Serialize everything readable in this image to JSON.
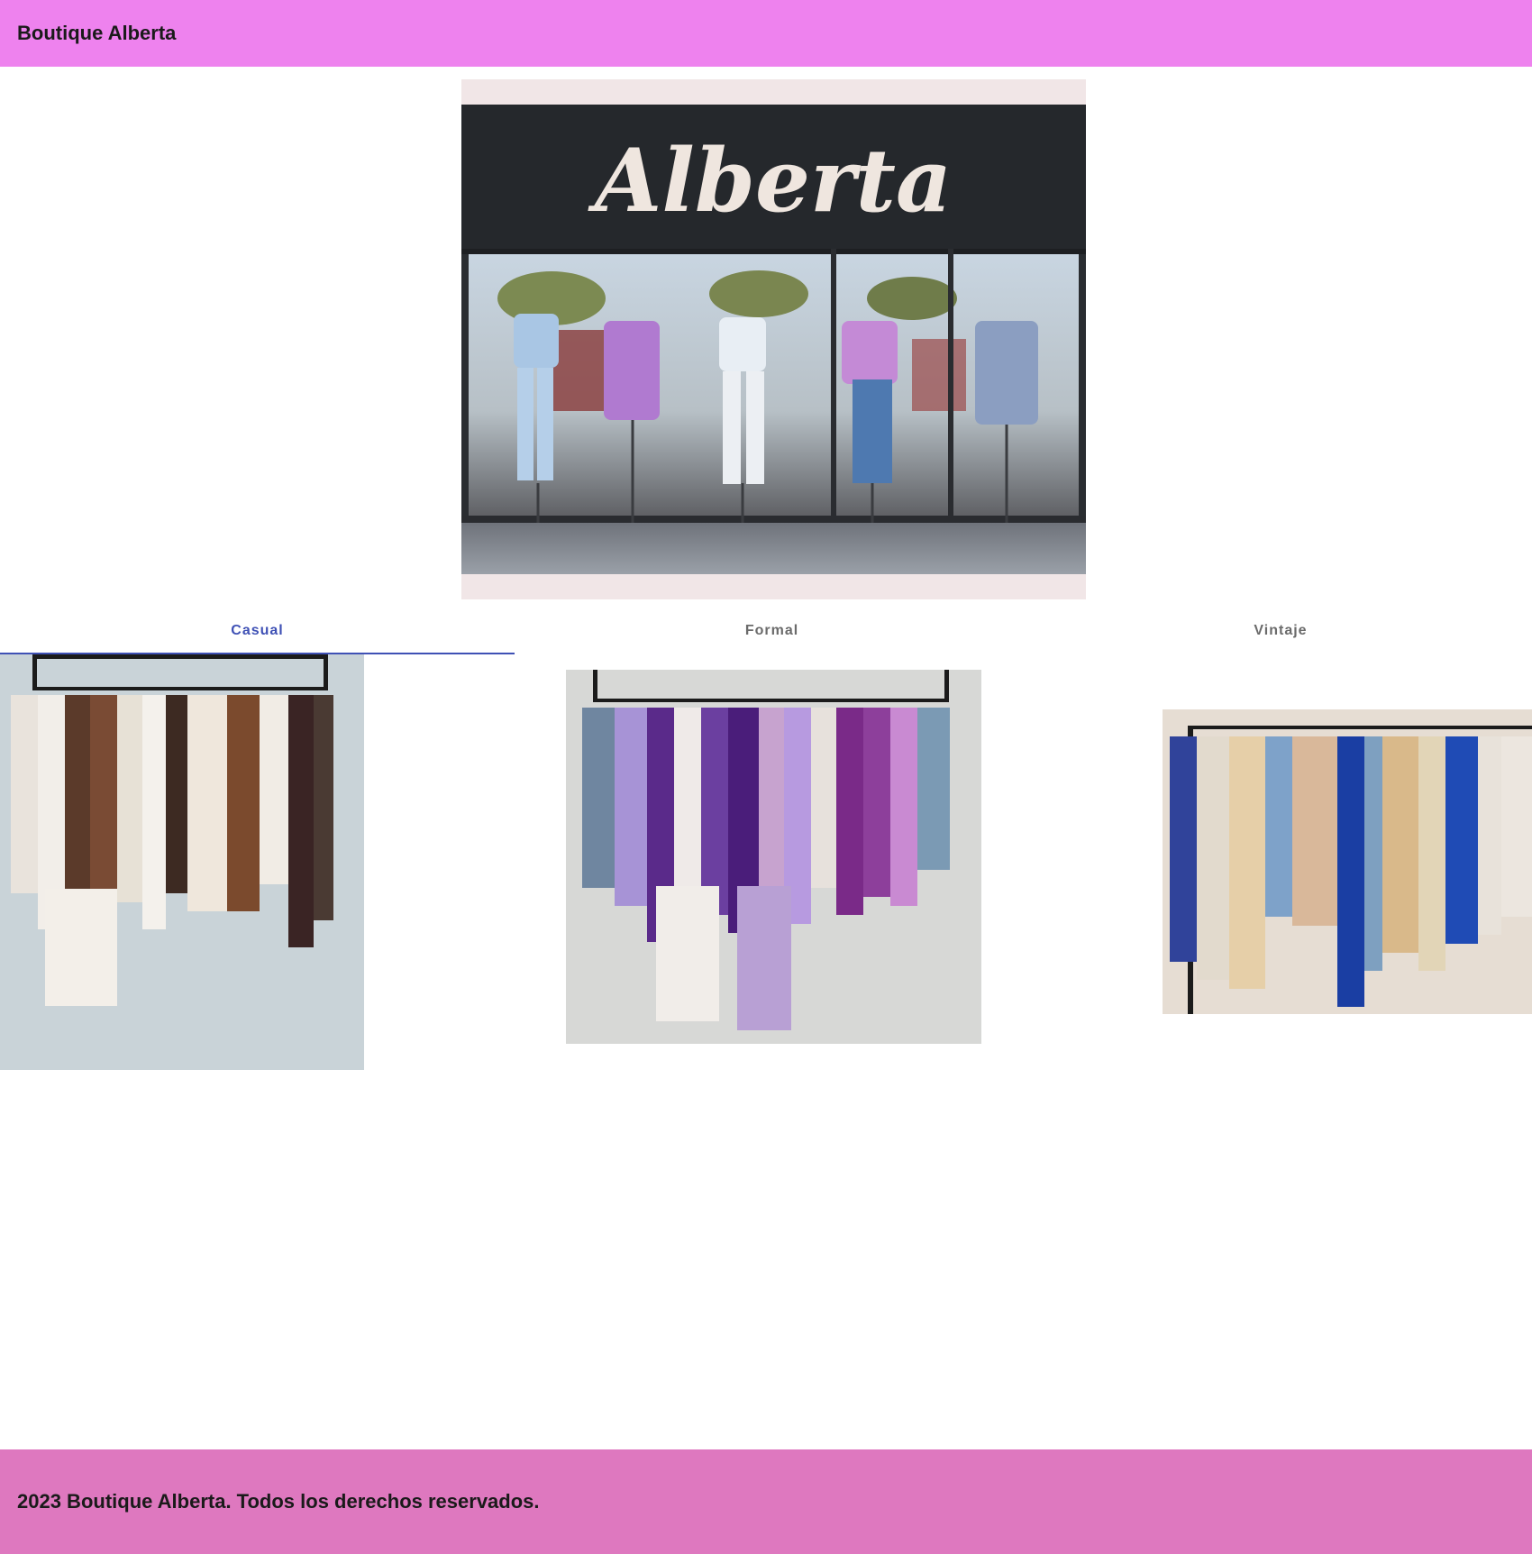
{
  "header": {
    "title": "Boutique Alberta"
  },
  "hero": {
    "sign_text": "Alberta",
    "alt": "Fachada de la tienda Boutique Alberta"
  },
  "tabs": [
    {
      "label": "Casual",
      "active": true
    },
    {
      "label": "Formal",
      "active": false
    },
    {
      "label": "Vintaje",
      "active": false
    }
  ],
  "panels": [
    {
      "category": "Casual"
    },
    {
      "category": "Formal"
    },
    {
      "category": "Vintaje"
    }
  ],
  "footer": {
    "text": "2023 Boutique Alberta. Todos los derechos reservados."
  },
  "colors": {
    "header_bg": "#ee82ee",
    "footer_bg": "#de78bf",
    "tab_active": "#3f51b5",
    "tab_inactive": "#6b6b6b"
  }
}
